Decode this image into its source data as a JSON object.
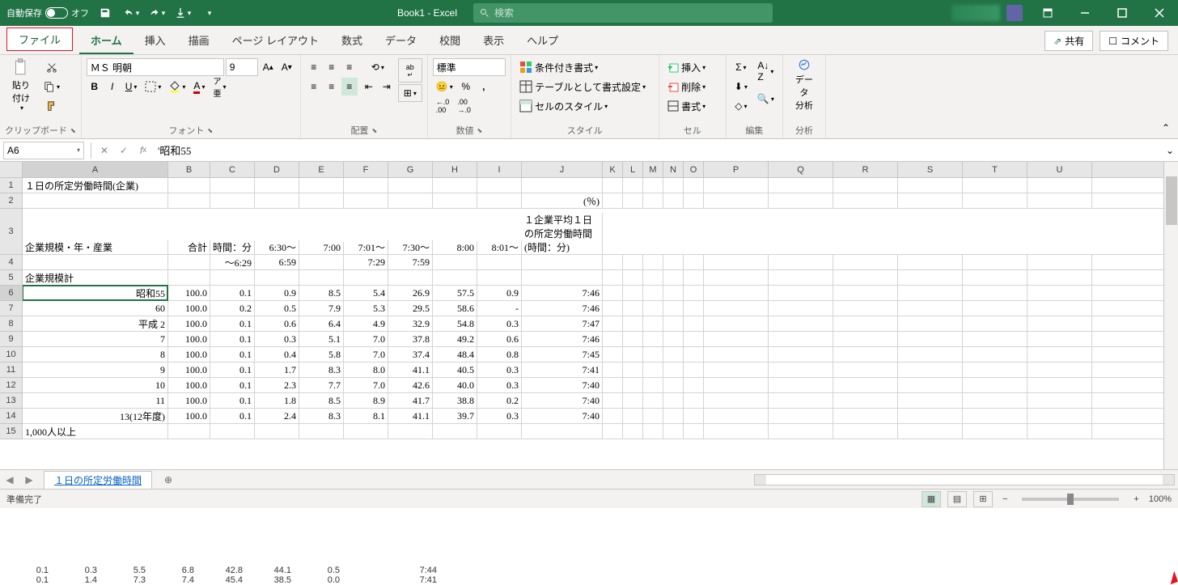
{
  "titlebar": {
    "autosave_label": "自動保存",
    "autosave_state": "オフ",
    "title": "Book1 - Excel",
    "search_placeholder": "検索"
  },
  "tabs": {
    "file": "ファイル",
    "items": [
      "ホーム",
      "挿入",
      "描画",
      "ページ レイアウト",
      "数式",
      "データ",
      "校閲",
      "表示",
      "ヘルプ"
    ],
    "active_index": 0,
    "share": "共有",
    "comment": "コメント"
  },
  "ribbon": {
    "clipboard": {
      "paste": "貼り付け",
      "label": "クリップボード"
    },
    "font": {
      "name": "ＭＳ 明朝",
      "size": "9",
      "label": "フォント"
    },
    "align": {
      "wrap": "ab",
      "label": "配置"
    },
    "number": {
      "format": "標準",
      "label": "数値"
    },
    "styles": {
      "cond": "条件付き書式",
      "table": "テーブルとして書式設定",
      "cell": "セルのスタイル",
      "label": "スタイル"
    },
    "cells": {
      "insert": "挿入",
      "delete": "削除",
      "format": "書式",
      "label": "セル"
    },
    "editing": {
      "label": "編集"
    },
    "analysis": {
      "btn": "データ\n分析",
      "label": "分析"
    }
  },
  "formula": {
    "name_box": "A6",
    "formula": "'昭和55"
  },
  "columns": [
    {
      "l": "A",
      "w": 180
    },
    {
      "l": "B",
      "w": 52
    },
    {
      "l": "C",
      "w": 55
    },
    {
      "l": "D",
      "w": 55
    },
    {
      "l": "E",
      "w": 55
    },
    {
      "l": "F",
      "w": 55
    },
    {
      "l": "G",
      "w": 55
    },
    {
      "l": "H",
      "w": 55
    },
    {
      "l": "I",
      "w": 55
    },
    {
      "l": "J",
      "w": 100
    },
    {
      "l": "K",
      "w": 25
    },
    {
      "l": "L",
      "w": 25
    },
    {
      "l": "M",
      "w": 25
    },
    {
      "l": "N",
      "w": 25
    },
    {
      "l": "O",
      "w": 25
    },
    {
      "l": "P",
      "w": 80
    },
    {
      "l": "Q",
      "w": 80
    },
    {
      "l": "R",
      "w": 80
    },
    {
      "l": "S",
      "w": 80
    },
    {
      "l": "T",
      "w": 80
    },
    {
      "l": "U",
      "w": 80
    }
  ],
  "rows": [
    {
      "n": 1,
      "cells": {
        "A": "１日の所定労働時間(企業)"
      }
    },
    {
      "n": 2,
      "cells": {
        "J": "(％)"
      }
    },
    {
      "n": 3,
      "cells": {
        "A": "企業規模・年・産業",
        "B": "合計",
        "C": "時間：分",
        "D": "6:30～",
        "E": "7:00",
        "F": "7:01～",
        "G": "7:30～",
        "H": "8:00",
        "I": "8:01～",
        "J": "１企業平均１日の所定労働時間　(時間：分)"
      }
    },
    {
      "n": 4,
      "cells": {
        "C": "～6:29",
        "D": "6:59",
        "F": "7:29",
        "G": "7:59"
      }
    },
    {
      "n": 5,
      "cells": {
        "A": "企業規模計"
      }
    },
    {
      "n": 6,
      "cells": {
        "A": "昭和55",
        "B": "100.0",
        "C": "0.1",
        "D": "0.9",
        "E": "8.5",
        "F": "5.4",
        "G": "26.9",
        "H": "57.5",
        "I": "0.9",
        "J": "7:46"
      }
    },
    {
      "n": 7,
      "cells": {
        "A": "60",
        "B": "100.0",
        "C": "0.2",
        "D": "0.5",
        "E": "7.9",
        "F": "5.3",
        "G": "29.5",
        "H": "58.6",
        "I": "-",
        "J": "7:46"
      }
    },
    {
      "n": 8,
      "cells": {
        "A": "平成 2",
        "B": "100.0",
        "C": "0.1",
        "D": "0.6",
        "E": "6.4",
        "F": "4.9",
        "G": "32.9",
        "H": "54.8",
        "I": "0.3",
        "J": "7:47"
      }
    },
    {
      "n": 9,
      "cells": {
        "A": "7",
        "B": "100.0",
        "C": "0.1",
        "D": "0.3",
        "E": "5.1",
        "F": "7.0",
        "G": "37.8",
        "H": "49.2",
        "I": "0.6",
        "J": "7:46"
      }
    },
    {
      "n": 10,
      "cells": {
        "A": "8",
        "B": "100.0",
        "C": "0.1",
        "D": "0.4",
        "E": "5.8",
        "F": "7.0",
        "G": "37.4",
        "H": "48.4",
        "I": "0.8",
        "J": "7:45"
      }
    },
    {
      "n": 11,
      "cells": {
        "A": "9",
        "B": "100.0",
        "C": "0.1",
        "D": "1.7",
        "E": "8.3",
        "F": "8.0",
        "G": "41.1",
        "H": "40.5",
        "I": "0.3",
        "J": "7:41"
      }
    },
    {
      "n": 12,
      "cells": {
        "A": "10",
        "B": "100.0",
        "C": "0.1",
        "D": "2.3",
        "E": "7.7",
        "F": "7.0",
        "G": "42.6",
        "H": "40.0",
        "I": "0.3",
        "J": "7:40"
      }
    },
    {
      "n": 13,
      "cells": {
        "A": "11",
        "B": "100.0",
        "C": "0.1",
        "D": "1.8",
        "E": "8.5",
        "F": "8.9",
        "G": "41.7",
        "H": "38.8",
        "I": "0.2",
        "J": "7:40"
      }
    },
    {
      "n": 14,
      "cells": {
        "A": "13(12年度)",
        "B": "100.0",
        "C": "0.1",
        "D": "2.4",
        "E": "8.3",
        "F": "8.1",
        "G": "41.1",
        "H": "39.7",
        "I": "0.3",
        "J": "7:40"
      }
    },
    {
      "n": 15,
      "cells": {
        "A": "1,000人以上"
      }
    }
  ],
  "active_cell": {
    "row": 6,
    "col": "A"
  },
  "sheet": {
    "name": "１日の所定労働時間"
  },
  "statusbar": {
    "ready": "準備完了",
    "zoom": "100%"
  },
  "extra": [
    [
      "0.1",
      "0.3",
      "5.5",
      "6.8",
      "42.8",
      "44.1",
      "0.5",
      "",
      "7:44"
    ],
    [
      "0.1",
      "1.4",
      "7.3",
      "7.4",
      "45.4",
      "38.5",
      "0.0",
      "",
      "7:41"
    ]
  ]
}
